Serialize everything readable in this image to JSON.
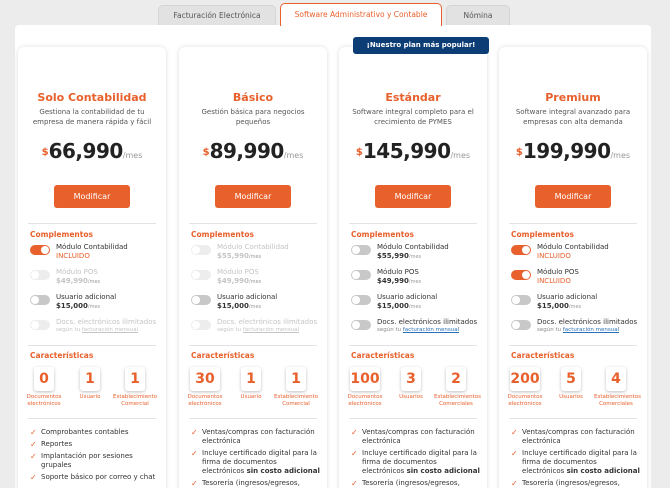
{
  "tabs": [
    {
      "label": "Facturación Electrónica",
      "active": false
    },
    {
      "label": "Software Administrativo y Contable",
      "active": true
    },
    {
      "label": "Nómina",
      "active": false
    }
  ],
  "popular_badge": "¡Nuestro plan más popular!",
  "labels": {
    "complementos": "Complementos",
    "caracteristicas": "Características",
    "modify": "Modificar",
    "currency": "$",
    "per": "/mes"
  },
  "colors": {
    "accent": "#e8602c",
    "badge": "#0d3d75",
    "link": "#2a70b8"
  },
  "plans": [
    {
      "name": "Solo Contabilidad",
      "desc": "Gestiona la contabilidad de tu empresa de manera rápida y fácil",
      "price": "66,990",
      "addons": [
        {
          "label": "Módulo Contabilidad",
          "sub": "INCLUIDO",
          "state": "on-included"
        },
        {
          "label": "Módulo POS",
          "price": "$49,990",
          "per": "/mes",
          "state": "disabled"
        },
        {
          "label": "Usuario adicional",
          "price": "$15,000",
          "per": "/mes",
          "state": "off"
        },
        {
          "label": "Docs. electrónicos ilimitados",
          "note": "según tu",
          "link": "facturación mensual",
          "state": "disabled"
        }
      ],
      "stats": [
        {
          "value": "0",
          "label": "Documentos electrónicos"
        },
        {
          "value": "1",
          "label": "Usuario"
        },
        {
          "value": "1",
          "label": "Establecimiento Comercial"
        }
      ],
      "features": [
        [
          "Comprobantes contables"
        ],
        [
          "Reportes"
        ],
        [
          "Implantación por sesiones grupales"
        ],
        [
          "Soporte básico por correo y chat"
        ]
      ]
    },
    {
      "name": "Básico",
      "desc": "Gestión básica para negocios pequeños",
      "price": "89,990",
      "addons": [
        {
          "label": "Módulo Contabilidad",
          "price": "$55,990",
          "per": "/mes",
          "state": "disabled"
        },
        {
          "label": "Módulo POS",
          "price": "$49,990",
          "per": "/mes",
          "state": "disabled"
        },
        {
          "label": "Usuario adicional",
          "price": "$15,000",
          "per": "/mes",
          "state": "off"
        },
        {
          "label": "Docs. electrónicos ilimitados",
          "note": "según tu",
          "link": "facturación mensual",
          "state": "disabled"
        }
      ],
      "stats": [
        {
          "value": "30",
          "label": "Documentos electrónicos"
        },
        {
          "value": "1",
          "label": "Usuario"
        },
        {
          "value": "1",
          "label": "Establecimiento Comercial"
        }
      ],
      "features": [
        [
          "Ventas/compras con facturación electrónica"
        ],
        [
          "Incluye certificado digital para la firma de documentos electrónicos",
          "sin costo adicional"
        ],
        [
          "Tesorería (ingresos/egresos, bancos/cajas)"
        ]
      ]
    },
    {
      "name": "Estándar",
      "desc": "Software integral completo para el crecimiento de PYMES",
      "price": "145,990",
      "addons": [
        {
          "label": "Módulo Contabilidad",
          "price": "$55,990",
          "per": "/mes",
          "state": "off"
        },
        {
          "label": "Módulo POS",
          "price": "$49,990",
          "per": "/mes",
          "state": "off"
        },
        {
          "label": "Usuario adicional",
          "price": "$15,000",
          "per": "/mes",
          "state": "off"
        },
        {
          "label": "Docs. electrónicos ilimitados",
          "note": "según tu",
          "link": "facturación mensual",
          "state": "off"
        }
      ],
      "stats": [
        {
          "value": "100",
          "label": "Documentos electrónicos"
        },
        {
          "value": "3",
          "label": "Usuarios"
        },
        {
          "value": "2",
          "label": "Establecimientos Comerciales"
        }
      ],
      "features": [
        [
          "Ventas/compras con facturación electrónica"
        ],
        [
          "Incluye certificado digital para la firma de documentos electrónicos",
          "sin costo adicional"
        ],
        [
          "Tesorería (ingresos/egresos, bancos/cajas)"
        ]
      ]
    },
    {
      "name": "Premium",
      "desc": "Software integral avanzado para empresas con alta demanda",
      "price": "199,990",
      "addons": [
        {
          "label": "Módulo Contabilidad",
          "sub": "INCLUIDO",
          "state": "on-included"
        },
        {
          "label": "Módulo POS",
          "sub": "INCLUIDO",
          "state": "on-included"
        },
        {
          "label": "Usuario adicional",
          "price": "$15,000",
          "per": "/mes",
          "state": "off"
        },
        {
          "label": "Docs. electrónicos ilimitados",
          "note": "según tu",
          "link": "facturación mensual",
          "state": "off"
        }
      ],
      "stats": [
        {
          "value": "200",
          "label": "Documentos electrónicos"
        },
        {
          "value": "5",
          "label": "Usuarios"
        },
        {
          "value": "4",
          "label": "Establecimientos Comerciales"
        }
      ],
      "features": [
        [
          "Ventas/compras con facturación electrónica"
        ],
        [
          "Incluye certificado digital para la firma de documentos electrónicos",
          "sin costo adicional"
        ],
        [
          "Tesorería (ingresos/egresos, bancos/cajas)"
        ]
      ]
    }
  ]
}
